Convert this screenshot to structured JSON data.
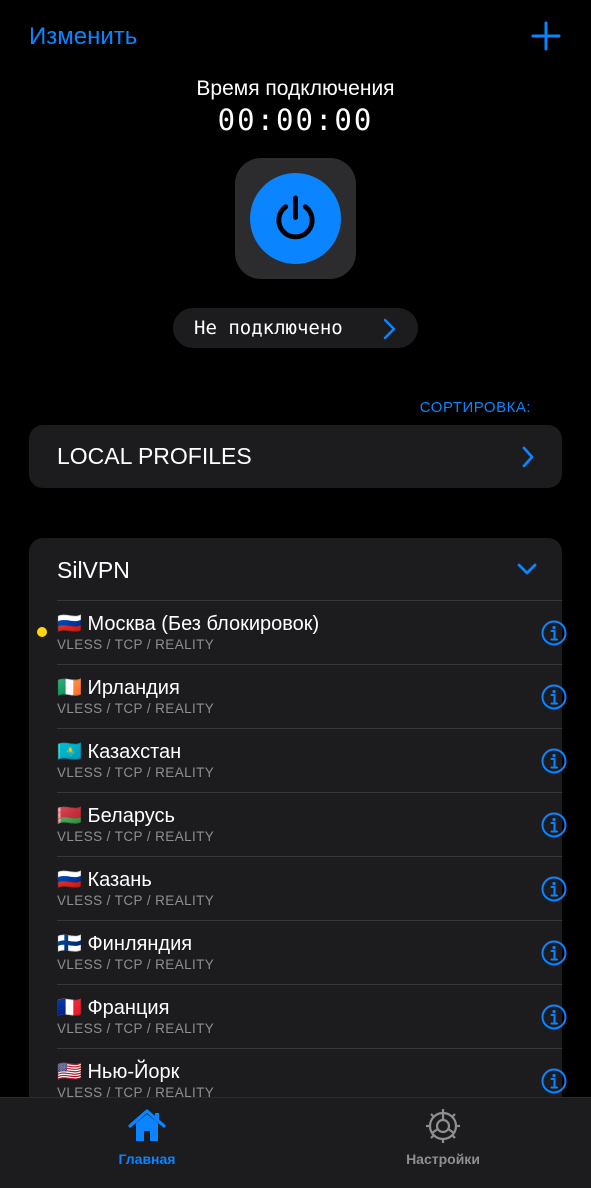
{
  "header": {
    "edit_label": "Изменить",
    "add_icon": "plus-icon"
  },
  "connection": {
    "title": "Время подключения",
    "timer": "00:00:00",
    "power_icon": "power-icon",
    "status": "Не подключено",
    "accent": "#0a84ff"
  },
  "sort_label": "СОРТИРОВКА:",
  "local_profiles": {
    "title": "LOCAL PROFILES"
  },
  "group": {
    "title": "SilVPN",
    "expanded": true,
    "servers": [
      {
        "name": "🇷🇺 Москва (Без блокировок)",
        "protocol": "VLESS / TCP / REALITY",
        "active": true
      },
      {
        "name": "🇮🇪 Ирландия",
        "protocol": "VLESS / TCP / REALITY",
        "active": false
      },
      {
        "name": "🇰🇿 Казахстан",
        "protocol": "VLESS / TCP / REALITY",
        "active": false
      },
      {
        "name": "🇧🇾 Беларусь",
        "protocol": "VLESS / TCP / REALITY",
        "active": false
      },
      {
        "name": " 🇷🇺 Казань",
        "protocol": "VLESS / TCP / REALITY",
        "active": false
      },
      {
        "name": "🇫🇮 Финляндия",
        "protocol": "VLESS / TCP / REALITY",
        "active": false
      },
      {
        "name": "🇫🇷 Франция",
        "protocol": "VLESS / TCP / REALITY",
        "active": false
      },
      {
        "name": "🇺🇸 Нью-Йорк",
        "protocol": "VLESS / TCP / REALITY",
        "active": false
      }
    ]
  },
  "active_indicator_color": "#ffd60a",
  "tabbar": {
    "home_label": "Главная",
    "settings_label": "Настройки",
    "home_icon": "house-icon",
    "settings_icon": "gear-icon"
  }
}
